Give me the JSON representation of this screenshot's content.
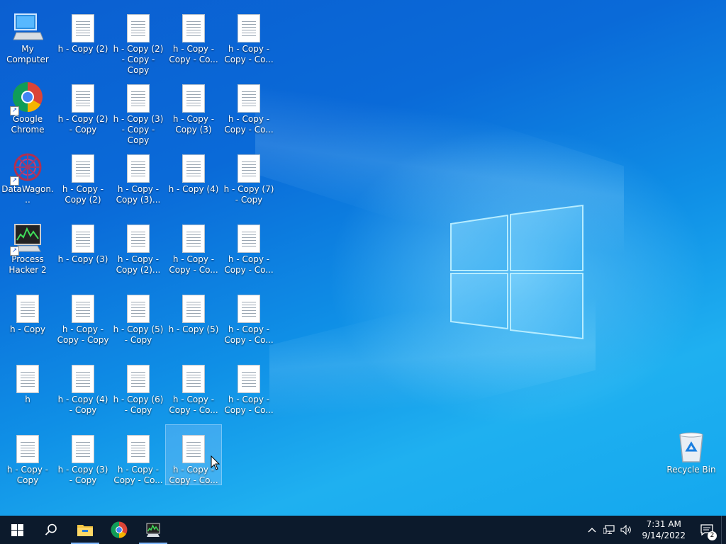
{
  "desktop": {
    "icons": {
      "my_computer": "My Computer",
      "google_chrome": "Google Chrome",
      "datawagon": "DataWagon...",
      "process_hacker": "Process Hacker 2",
      "h_copy": "h - Copy",
      "h": "h",
      "h_copy_copy": "h - Copy - Copy",
      "c1_r0": "h - Copy (2)",
      "c1_r1": "h - Copy (2) - Copy",
      "c1_r2": "h - Copy - Copy (2)",
      "c1_r3": "h - Copy (3)",
      "c1_r4": "h - Copy - Copy - Copy",
      "c1_r5": "h - Copy (4) - Copy",
      "c1_r6": "h - Copy (3) - Copy",
      "c2_r0": "h - Copy (2) - Copy - Copy",
      "c2_r1": "h - Copy (3) - Copy - Copy",
      "c2_r2": "h - Copy - Copy (3)...",
      "c2_r3": "h - Copy - Copy (2)...",
      "c2_r4": "h - Copy (5) - Copy",
      "c2_r5": "h - Copy (6) - Copy",
      "c2_r6": "h - Copy - Copy - Co...",
      "c3_r0": "h - Copy - Copy - Co...",
      "c3_r1": "h - Copy - Copy (3)",
      "c3_r2": "h - Copy (4)",
      "c3_r3": "h - Copy - Copy - Co...",
      "c3_r4": "h - Copy (5)",
      "c3_r5": "h - Copy - Copy - Co...",
      "c3_r6": "h - Copy - Copy - Co...",
      "c4_r0": "h - Copy - Copy - Co...",
      "c4_r1": "h - Copy - Copy - Co...",
      "c4_r2": "h - Copy (7) - Copy",
      "c4_r3": "h - Copy - Copy - Co...",
      "c4_r4": "h - Copy - Copy - Co...",
      "c4_r5": "h - Copy - Copy - Co...",
      "recycle_bin": "Recycle Bin"
    }
  },
  "taskbar": {
    "time": "7:31 AM",
    "date": "9/14/2022",
    "notification_count": "2"
  },
  "colors": {
    "taskbar_bg": "#0c1a2c",
    "desktop_accent": "#0a6ad8"
  }
}
